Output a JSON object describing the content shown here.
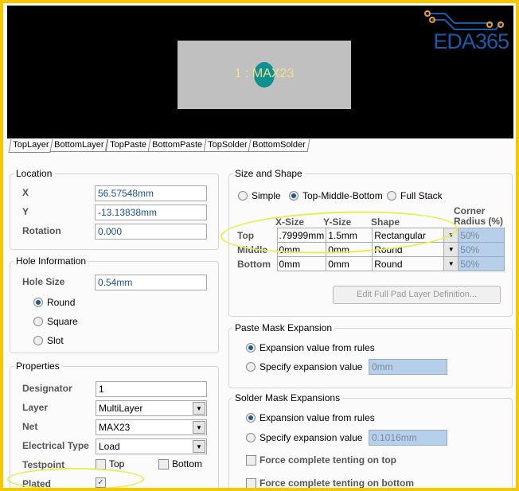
{
  "preview": {
    "pad_label": "1 : MAX23",
    "logo": "EDA365"
  },
  "tabs": [
    "TopLayer",
    "BottomLayer",
    "TopPaste",
    "BottomPaste",
    "TopSolder",
    "BottomSolder"
  ],
  "location": {
    "title": "Location",
    "x_label": "X",
    "x": "56.57548mm",
    "y_label": "Y",
    "y": "-13.13838mm",
    "rot_label": "Rotation",
    "rot": "0.000"
  },
  "hole": {
    "title": "Hole Information",
    "size_label": "Hole Size",
    "size": "0.54mm",
    "shapes": [
      "Round",
      "Square",
      "Slot"
    ],
    "selected": "Round"
  },
  "props": {
    "title": "Properties",
    "designator_label": "Designator",
    "designator": "1",
    "layer_label": "Layer",
    "layer": "MultiLayer",
    "net_label": "Net",
    "net": "MAX23",
    "etype_label": "Electrical Type",
    "etype": "Load",
    "testpoint_label": "Testpoint",
    "tp_top": "Top",
    "tp_bottom": "Bottom",
    "plated_label": "Plated",
    "plated": true
  },
  "size_shape": {
    "title": "Size and Shape",
    "modes": [
      "Simple",
      "Top-Middle-Bottom",
      "Full Stack"
    ],
    "selected": "Top-Middle-Bottom",
    "headers": [
      "X-Size",
      "Y-Size",
      "Shape",
      "Corner Radius (%)"
    ],
    "rows": [
      {
        "name": "Top",
        "x": ".79999mm",
        "y": "1.5mm",
        "shape": "Rectangular",
        "radius": "50%"
      },
      {
        "name": "Middle",
        "x": "0mm",
        "y": "0mm",
        "shape": "Round",
        "radius": "50%"
      },
      {
        "name": "Bottom",
        "x": "0mm",
        "y": "0mm",
        "shape": "Round",
        "radius": "50%"
      }
    ],
    "edit_button": "Edit Full Pad Layer Definition..."
  },
  "paste": {
    "title": "Paste Mask Expansion",
    "opt1": "Expansion value from rules",
    "opt2": "Specify expansion value",
    "value": "0mm"
  },
  "solder": {
    "title": "Solder Mask Expansions",
    "opt1": "Expansion value from rules",
    "opt2": "Specify expansion value",
    "value": "0.1016mm",
    "tent_top": "Force complete tenting on top",
    "tent_bottom": "Force complete tenting on bottom"
  }
}
